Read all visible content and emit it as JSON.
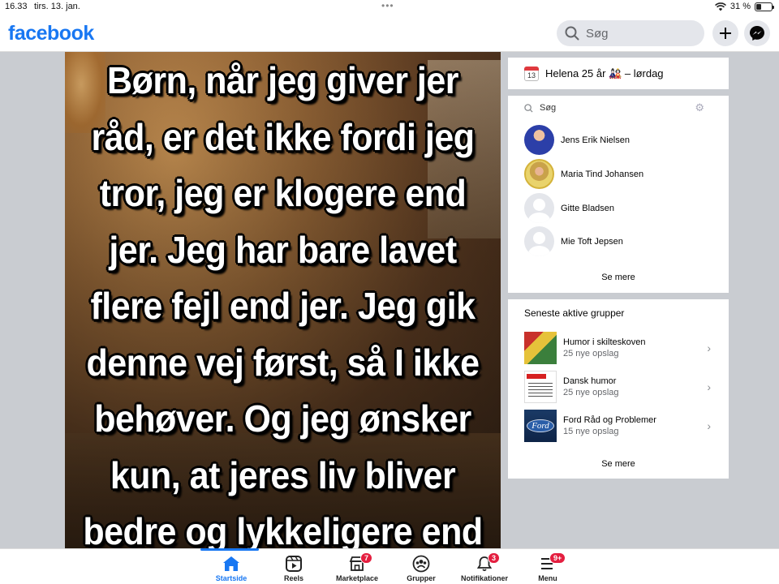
{
  "status_bar": {
    "time": "16.33",
    "date": "tirs. 13. jan.",
    "battery": "31 %",
    "battery_level": 0.31
  },
  "header": {
    "logo": "facebook",
    "search_placeholder": "Søg",
    "brand_color": "#1877f2"
  },
  "post": {
    "lines": [
      "Børn, når jeg giver jer",
      "råd, er det ikke fordi jeg",
      "tror, jeg er klogere end",
      "jer. Jeg har bare lavet",
      "flere fejl end jer. Jeg gik",
      "denne vej først, så I ikke",
      "behøver. Og jeg ønsker",
      "kun, at jeres liv bliver",
      "bedre og lykkeligere end"
    ]
  },
  "birthday": {
    "calendar_day": "13",
    "text": "Helena 25 år 🎎 – lørdag"
  },
  "contacts": {
    "search_placeholder": "Søg",
    "items": [
      {
        "name": "Jens Erik Nielsen"
      },
      {
        "name": "Maria Tind Johansen"
      },
      {
        "name": "Gitte Bladsen"
      },
      {
        "name": "Mie Toft Jepsen"
      }
    ],
    "see_more": "Se mere"
  },
  "groups": {
    "heading": "Seneste aktive grupper",
    "items": [
      {
        "name": "Humor i skilteskoven",
        "sub": "25 nye opslag"
      },
      {
        "name": "Dansk humor",
        "sub": "25 nye opslag"
      },
      {
        "name": "Ford Råd og Problemer",
        "sub": "15 nye opslag",
        "thumb_text": "Ford"
      }
    ],
    "see_more": "Se mere"
  },
  "bottom_nav": {
    "items": [
      {
        "label": "Startside",
        "icon": "home-icon",
        "active": true
      },
      {
        "label": "Reels",
        "icon": "reels-icon"
      },
      {
        "label": "Marketplace",
        "icon": "marketplace-icon",
        "badge": "7"
      },
      {
        "label": "Grupper",
        "icon": "groups-icon"
      },
      {
        "label": "Notifikationer",
        "icon": "bell-icon",
        "badge": "3"
      },
      {
        "label": "Menu",
        "icon": "menu-icon",
        "badge": "9+"
      }
    ]
  }
}
